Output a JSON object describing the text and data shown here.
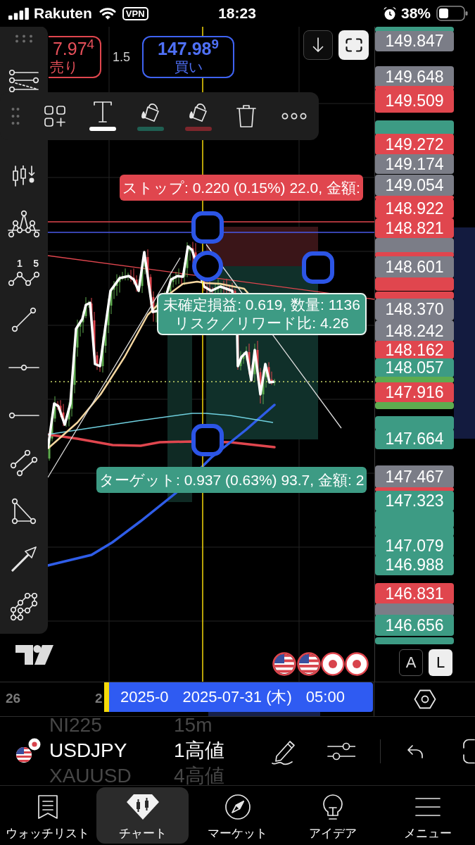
{
  "status_bar": {
    "carrier": "Rakuten",
    "vpn": "VPN",
    "time": "18:23",
    "battery": "38%"
  },
  "order_panel": {
    "sell_price": "7.97$^{4}$",
    "sell_label": "売り",
    "spread": "1.5",
    "buy_price": "147.98$^{9}$",
    "buy_label": "買い"
  },
  "left_toolbar": {
    "wave_labels": [
      "1",
      "5"
    ]
  },
  "style_toolbar": {
    "swatches": [
      {
        "color": "#ffffff"
      },
      {
        "color": "#1f5f52"
      },
      {
        "color": "#7d262c"
      }
    ]
  },
  "position_tool": {
    "stop_label": "ストップ: 0.220 (0.15%) 22.0, 金額:",
    "info_lines": [
      "未確定損益: 0.619, 数量: 1136",
      "リスク／リワード比: 4.26"
    ],
    "target_label": "ターゲット: 0.937 (0.63%) 93.7, 金額: 2"
  },
  "price_axis": {
    "tags": [
      {
        "color": "#3d9b84"
      },
      {
        "label": "149.847",
        "color": "#7b7d87"
      },
      {
        "label": "149.648",
        "color": "#7b7d87"
      },
      {
        "color": "#e0464e"
      },
      {
        "label": "149.509",
        "color": "#e0464e"
      },
      {
        "color": "#3d9b84"
      },
      {
        "label": "149.272",
        "color": "#e0464e"
      },
      {
        "label": "149.174",
        "color": "#7b7d87"
      },
      {
        "label": "149.054",
        "color": "#7b7d87"
      },
      {
        "color": "#e0464e"
      },
      {
        "label": "148.922",
        "color": "#e0464e"
      },
      {
        "label": "148.821",
        "color": "#e0464e"
      },
      {
        "color": "#7b7d87"
      },
      {
        "color": "#e0464e"
      },
      {
        "label": "148.601",
        "color": "#7b7d87"
      },
      {
        "color": "#e0464e"
      },
      {
        "color": "#e0464e"
      },
      {
        "label": "148.370",
        "color": "#7b7d87"
      },
      {
        "label": "148.242",
        "color": "#7b7d87"
      },
      {
        "label": "148.162",
        "color": "#e0464e"
      },
      {
        "label": "148.057",
        "color": "#3d9b84"
      },
      {
        "color": "#5eab4f"
      },
      {
        "label": "147.916",
        "color": "#e0464e"
      },
      {
        "color": "#5eab4f"
      },
      {
        "color": "#3d9b84"
      },
      {
        "label": "147.664",
        "color": "#3d9b84"
      },
      {
        "label": "147.467",
        "color": "#7b7d87"
      },
      {
        "color": "#e0464e"
      },
      {
        "label": "147.323",
        "color": "#3d9b84"
      },
      {
        "color": "#3d9b84"
      },
      {
        "color": "#3d9b84"
      },
      {
        "label": "147.079",
        "color": "#3d9b84"
      },
      {
        "label": "146.988",
        "color": "#3d9b84"
      },
      {
        "label": "146.831",
        "color": "#e0464e"
      },
      {
        "color": "#7b7d87"
      },
      {
        "label": "146.656",
        "color": "#3d9b84"
      },
      {
        "color": "#3d9b84"
      }
    ],
    "scale_buttons": [
      {
        "label": "A",
        "selected": false
      },
      {
        "label": "L",
        "selected": true
      }
    ]
  },
  "time_axis": {
    "ticks": [
      "26",
      "2"
    ],
    "cursor_label": [
      "2025-0",
      "2025-07-31 (木)",
      "05:00"
    ]
  },
  "symbol_picker": [
    {
      "symbol": "NI225",
      "interval": "15m",
      "selected": false
    },
    {
      "symbol": "USDJPY",
      "interval": "1高値",
      "selected": true
    },
    {
      "symbol": "XAUUSD",
      "interval": "4高値",
      "selected": false
    }
  ],
  "tab_bar": [
    {
      "label": "ウォッチリスト",
      "selected": false
    },
    {
      "label": "チャート",
      "selected": true
    },
    {
      "label": "マーケット",
      "selected": false
    },
    {
      "label": "アイデア",
      "selected": false
    },
    {
      "label": "メニュー",
      "selected": false
    }
  ]
}
